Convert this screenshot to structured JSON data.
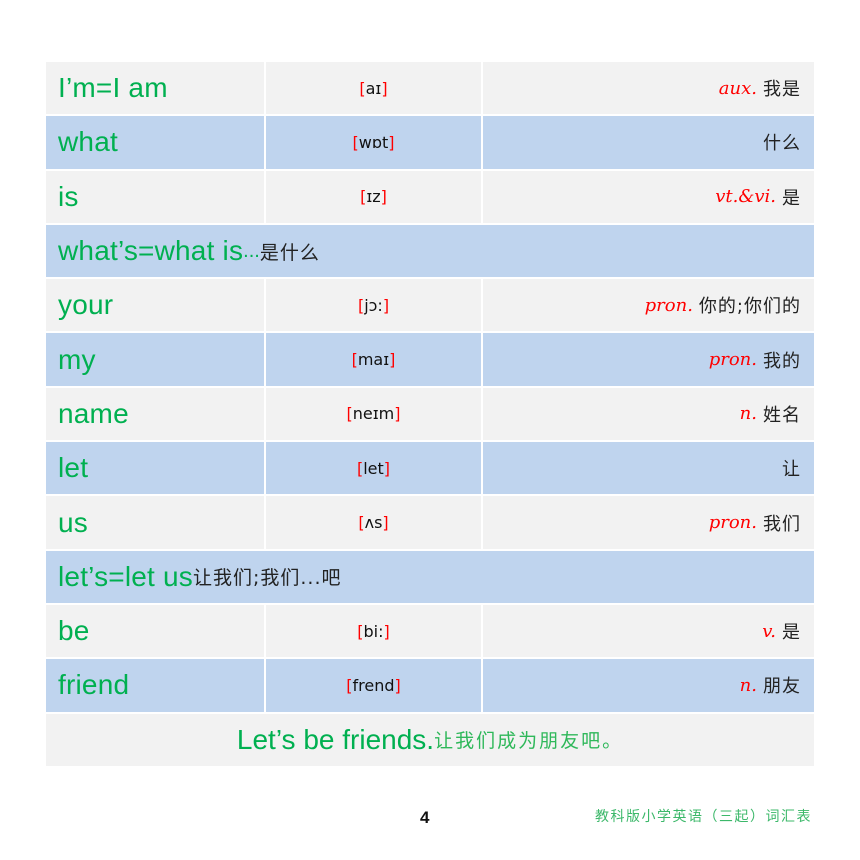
{
  "vocab_rows": [
    {
      "type": "word",
      "style": "light",
      "word": "I’m=I am",
      "ipa": "aɪ",
      "pos": "aux.",
      "meaning": "我是"
    },
    {
      "type": "word",
      "style": "blue",
      "word": "what",
      "ipa": "wɒt",
      "pos": "",
      "meaning": "什么"
    },
    {
      "type": "word",
      "style": "light",
      "word": "is",
      "ipa": "ɪz",
      "pos": "vt.&vi.",
      "meaning": "是"
    },
    {
      "type": "phrase",
      "style": "blue",
      "word": "what’s=what is",
      "ellipsis": "...",
      "meaning": "是什么"
    },
    {
      "type": "word",
      "style": "light",
      "word": "your",
      "ipa": "jɔ:",
      "pos": "pron.",
      "meaning": "你的;你们的"
    },
    {
      "type": "word",
      "style": "blue",
      "word": "my",
      "ipa": "maɪ",
      "pos": "pron.",
      "meaning": "我的"
    },
    {
      "type": "word",
      "style": "light",
      "word": "name",
      "ipa": "neɪm",
      "pos": "n.",
      "meaning": "姓名"
    },
    {
      "type": "word",
      "style": "blue",
      "word": "let",
      "ipa": "let",
      "pos": "",
      "meaning": "让"
    },
    {
      "type": "word",
      "style": "light",
      "word": "us",
      "ipa": "ʌs",
      "pos": "pron.",
      "meaning": "我们"
    },
    {
      "type": "phrase",
      "style": "blue",
      "word": "let’s=let us",
      "ellipsis": "",
      "meaning": " 让我们;我们...吧"
    },
    {
      "type": "word",
      "style": "light",
      "word": "be",
      "ipa": "bi:",
      "pos": "v.",
      "meaning": "是"
    },
    {
      "type": "word",
      "style": "blue",
      "word": "friend",
      "ipa": "frend",
      "pos": "n.",
      "meaning": "朋友"
    },
    {
      "type": "sentence",
      "style": "light",
      "word": "Let’s be friends.",
      "meaning": "让我们成为朋友吧。"
    }
  ],
  "ipa_brackets": {
    "open": "[",
    "close": "]"
  },
  "footer": {
    "page_number": "4",
    "book_title": "教科版小学英语（三起）词汇表"
  }
}
